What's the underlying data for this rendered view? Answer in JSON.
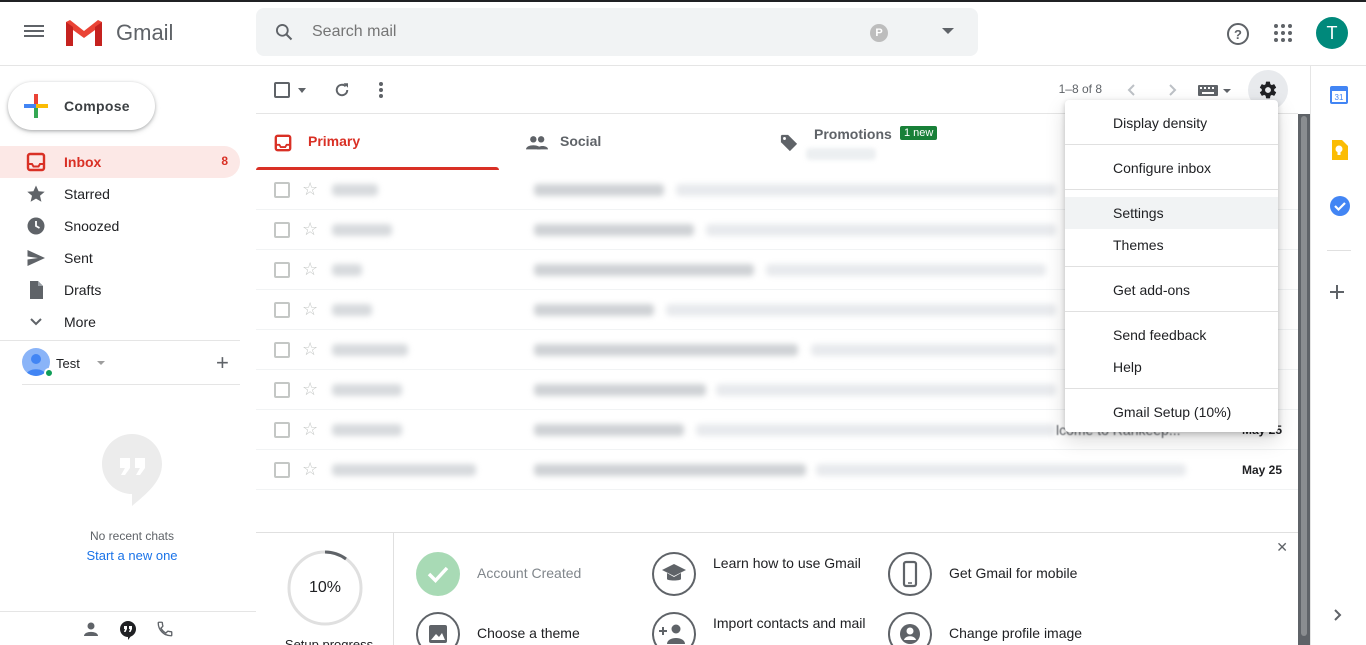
{
  "app": {
    "name": "Gmail",
    "avatar_letter": "T"
  },
  "search": {
    "placeholder": "Search mail"
  },
  "compose": {
    "label": "Compose"
  },
  "nav": [
    {
      "label": "Inbox",
      "count": "8",
      "icon": "inbox-icon",
      "active": true
    },
    {
      "label": "Starred",
      "icon": "star-icon"
    },
    {
      "label": "Snoozed",
      "icon": "clock-icon"
    },
    {
      "label": "Sent",
      "icon": "send-icon"
    },
    {
      "label": "Drafts",
      "icon": "drafts-icon"
    },
    {
      "label": "More",
      "icon": "chevron-down-icon"
    }
  ],
  "hangouts": {
    "user": "Test",
    "no_chats": "No recent chats",
    "new_chat": "Start a new one"
  },
  "toolbar": {
    "pager": "1–8 of 8"
  },
  "tabs": [
    {
      "label": "Primary",
      "icon": "inbox-icon"
    },
    {
      "label": "Social",
      "icon": "people-icon"
    },
    {
      "label": "Promotions",
      "icon": "tag-icon",
      "badge": "1 new"
    }
  ],
  "rows": [
    {
      "date": ""
    },
    {
      "date": ""
    },
    {
      "date": ""
    },
    {
      "date": ""
    },
    {
      "date": ""
    },
    {
      "date": ""
    },
    {
      "date": "May 25",
      "peek": "lcome to Rankeep..."
    },
    {
      "date": "May 25"
    }
  ],
  "settings_menu": {
    "items": [
      "Display density",
      "Configure inbox",
      "Settings",
      "Themes",
      "Get add-ons",
      "Send feedback",
      "Help",
      "Gmail Setup (10%)"
    ],
    "highlighted": "Settings"
  },
  "setup": {
    "progress": "10%",
    "progress_label": "Setup progress",
    "steps": [
      {
        "label": "Account Created",
        "done": true
      },
      {
        "label": "Learn how to use Gmail"
      },
      {
        "label": "Get Gmail for mobile"
      },
      {
        "label": "Choose a theme"
      },
      {
        "label": "Import contacts and mail"
      },
      {
        "label": "Change profile image"
      }
    ]
  },
  "colors": {
    "accent_red": "#d93025",
    "active_bg": "#fce8e6",
    "avatar": "#00897b",
    "badge_green": "#188038"
  }
}
